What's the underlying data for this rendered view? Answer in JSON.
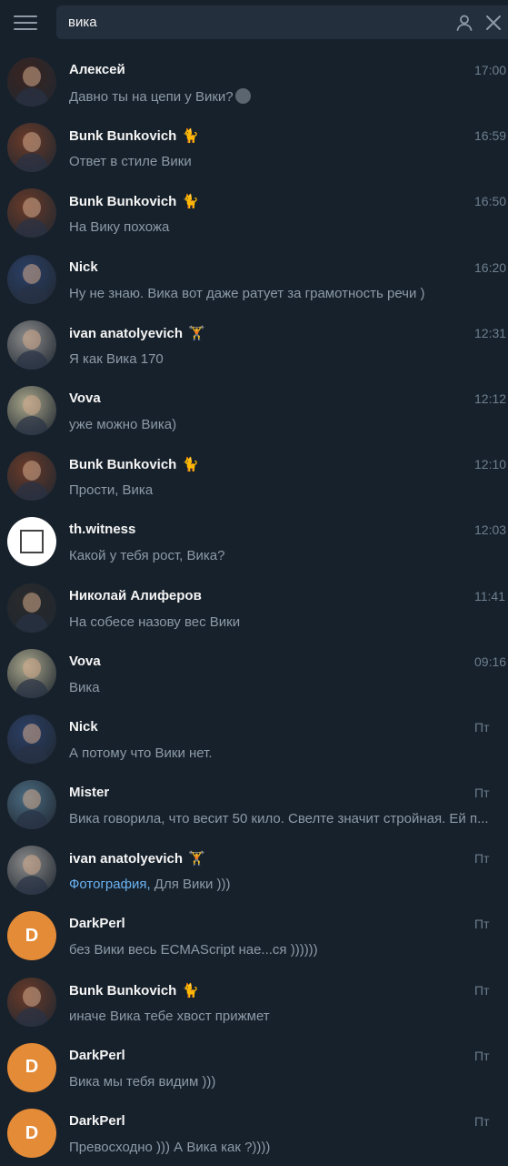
{
  "search": {
    "value": "вика"
  },
  "colors": {
    "background": "#17212b",
    "search_bg": "#242f3d",
    "accent_link": "#6ab3f3",
    "letter_avatar": "#e48b38"
  },
  "results": [
    {
      "name": "Алексей",
      "badge": "",
      "time": "17:00",
      "message": "Давно ты на цепи у Вики?",
      "media": "",
      "emoji": "smiley-icon",
      "avatar": "photo",
      "avatar_color": "#3a2420"
    },
    {
      "name": "Bunk Bunkovich",
      "badge": "🐈",
      "time": "16:59",
      "message": "Ответ в стиле Вики",
      "media": "",
      "avatar": "photo",
      "avatar_color": "#6a3a28"
    },
    {
      "name": "Bunk Bunkovich",
      "badge": "🐈",
      "time": "16:50",
      "message": "На Вику похожа",
      "media": "",
      "avatar": "photo",
      "avatar_color": "#6a3a28"
    },
    {
      "name": "Nick",
      "badge": "",
      "time": "16:20",
      "message": "Ну не знаю. Вика вот даже ратует за грамотность речи )",
      "media": "",
      "avatar": "photo",
      "avatar_color": "#2b3f66"
    },
    {
      "name": "ivan anatolyevich",
      "badge": "🏋",
      "time": "12:31",
      "message": "Я как Вика 170",
      "media": "",
      "avatar": "photo",
      "avatar_color": "#8a8a8a"
    },
    {
      "name": "Vova",
      "badge": "",
      "time": "12:12",
      "message": "уже можно Вика)",
      "media": "",
      "avatar": "photo",
      "avatar_color": "#a8a58a"
    },
    {
      "name": "Bunk Bunkovich",
      "badge": "🐈",
      "time": "12:10",
      "message": "Прости, Вика",
      "media": "",
      "avatar": "photo",
      "avatar_color": "#6a3a28"
    },
    {
      "name": "th.witness",
      "badge": "",
      "time": "12:03",
      "message": "Какой у тебя рост, Вика?",
      "media": "",
      "avatar": "photo-white",
      "avatar_color": "#ffffff"
    },
    {
      "name": "Николай Алиферов",
      "badge": "",
      "time": "11:41",
      "message": "На собесе назову вес Вики",
      "media": "",
      "avatar": "photo",
      "avatar_color": "#2a2a2a"
    },
    {
      "name": "Vova",
      "badge": "",
      "time": "09:16",
      "message": "Вика",
      "media": "",
      "avatar": "photo",
      "avatar_color": "#a8a58a"
    },
    {
      "name": "Nick",
      "badge": "",
      "time": "Пт",
      "message": "А потому что Вики нет.",
      "media": "",
      "avatar": "photo",
      "avatar_color": "#2b3f66"
    },
    {
      "name": "Mister",
      "badge": "",
      "time": "Пт",
      "message": "Вика говорила, что весит 50 кило. Свелте значит стройная. Ей п...",
      "media": "",
      "avatar": "photo",
      "avatar_color": "#4a6a80"
    },
    {
      "name": "ivan anatolyevich",
      "badge": "🏋",
      "time": "Пт",
      "message": " Для Вики )))",
      "media": "Фотография,",
      "avatar": "photo",
      "avatar_color": "#8a8a8a"
    },
    {
      "name": "DarkPerl",
      "badge": "",
      "time": "Пт",
      "message": "без Вики весь ECMAScript нае...ся ))))))",
      "media": "",
      "avatar": "letter",
      "letter": "D",
      "avatar_color": "#e48b38"
    },
    {
      "name": "Bunk Bunkovich",
      "badge": "🐈",
      "time": "Пт",
      "message": "иначе Вика тебе хвост прижмет",
      "media": "",
      "avatar": "photo",
      "avatar_color": "#6a3a28"
    },
    {
      "name": "DarkPerl",
      "badge": "",
      "time": "Пт",
      "message": "Вика мы тебя видим )))",
      "media": "",
      "avatar": "letter",
      "letter": "D",
      "avatar_color": "#e48b38"
    },
    {
      "name": "DarkPerl",
      "badge": "",
      "time": "Пт",
      "message": "Превосходно ))) А Вика как ?))))",
      "media": "",
      "avatar": "letter",
      "letter": "D",
      "avatar_color": "#e48b38"
    }
  ]
}
